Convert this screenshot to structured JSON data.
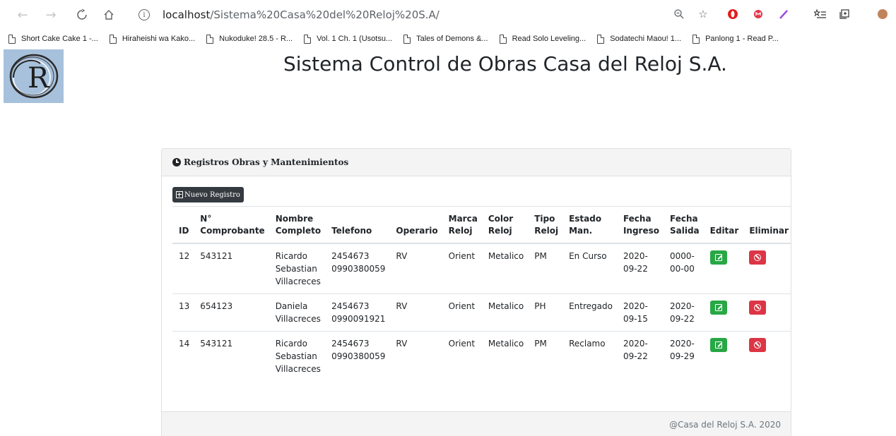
{
  "browser": {
    "url_host": "localhost",
    "url_path": "/Sistema%20Casa%20del%20Reloj%20S.A/",
    "bookmarks": [
      "Short Cake Cake 1 -...",
      "Hiraheishi wa Kako...",
      "Nukoduke! 28.5 - R...",
      "Vol. 1 Ch. 1 (Usotsu...",
      "Tales of Demons &...",
      "Read Solo Leveling...",
      "Sodatechi Maou! 1...",
      "Panlong 1 - Read P..."
    ]
  },
  "page": {
    "logo_text": "CR",
    "title": "Sistema Control de Obras Casa del Reloj S.A."
  },
  "card": {
    "header": "Registros Obras y Mantenimientos",
    "new_button": "Nuevo Registro",
    "columns": [
      "ID",
      "N° Comprobante",
      "Nombre Completo",
      "Telefono",
      "Operario",
      "Marca Reloj",
      "Color Reloj",
      "Tipo Reloj",
      "Estado Man.",
      "Fecha Ingreso",
      "Fecha Salida",
      "Editar",
      "Eliminar"
    ],
    "rows": [
      {
        "id": "12",
        "comprobante": "543121",
        "nombre": "Ricardo Sebastian Villacreces",
        "telefono": "2454673 0990380059",
        "operario": "RV",
        "marca": "Orient",
        "color": "Metalico",
        "tipo": "PM",
        "estado": "En Curso",
        "ingreso": "2020-09-22",
        "salida": "0000-00-00"
      },
      {
        "id": "13",
        "comprobante": "654123",
        "nombre": "Daniela Villacreces",
        "telefono": "2454673 0990091921",
        "operario": "RV",
        "marca": "Orient",
        "color": "Metalico",
        "tipo": "PH",
        "estado": "Entregado",
        "ingreso": "2020-09-15",
        "salida": "2020-09-22"
      },
      {
        "id": "14",
        "comprobante": "543121",
        "nombre": "Ricardo Sebastian Villacreces",
        "telefono": "2454673 0990380059",
        "operario": "RV",
        "marca": "Orient",
        "color": "Metalico",
        "tipo": "PM",
        "estado": "Reclamo",
        "ingreso": "2020-09-22",
        "salida": "2020-09-29"
      }
    ],
    "footer": "@Casa del Reloj S.A. 2020"
  },
  "colors": {
    "edit": "#28a745",
    "delete": "#dc3545",
    "dark_button": "#343a40",
    "logo_bg": "#a7c1dc"
  }
}
